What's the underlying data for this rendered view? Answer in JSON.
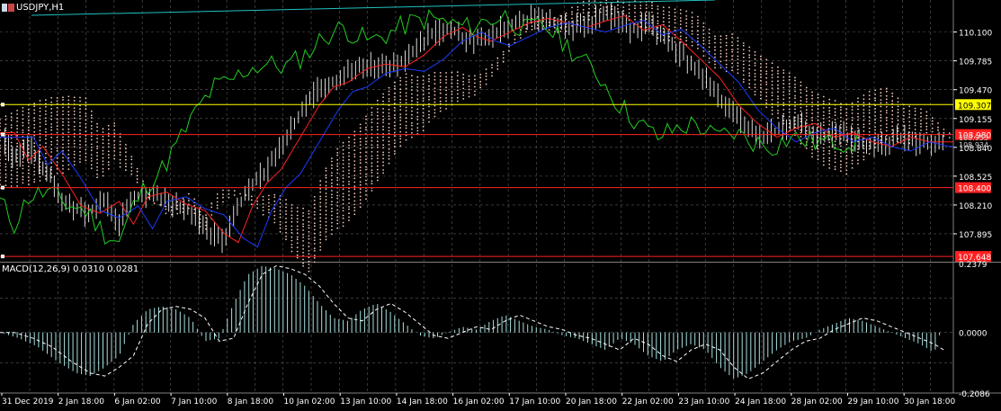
{
  "window": {
    "symbol_title": "USDJPY,H1",
    "macd_title": "MACD(12,26,9) 0.0310 0.0281"
  },
  "colors": {
    "background": "#000000",
    "grid": "#5a5a5a",
    "axis_text": "#ffffff",
    "price_bars": "#ffffff",
    "fast_ma": "#ff2020",
    "slow_ma": "#1a3cff",
    "chikou": "#22cc22",
    "cloud": "#f4c8b8",
    "horizontal_yellow": "#ffff00",
    "horizontal_red": "#ff2020",
    "trend_line": "#20c0c0",
    "macd_histogram": "#a8e0e0",
    "macd_signal": "#ffffff"
  },
  "chart_data": [
    {
      "type": "candlestick",
      "symbol": "USDJPY",
      "timeframe": "H1",
      "x_labels": [
        "31 Dec 2019",
        "2 Jan 18:00",
        "6 Jan 02:00",
        "7 Jan 10:00",
        "8 Jan 18:00",
        "10 Jan 02:00",
        "13 Jan 10:00",
        "14 Jan 18:00",
        "16 Jan 02:00",
        "17 Jan 10:00",
        "20 Jan 18:00",
        "22 Jan 02:00",
        "23 Jan 10:00",
        "24 Jan 18:00",
        "28 Jan 02:00",
        "29 Jan 10:00",
        "30 Jan 18:00"
      ],
      "y_ticks": [
        110.1,
        109.785,
        109.47,
        109.155,
        108.84,
        108.525,
        108.21,
        107.895
      ],
      "y_tick_labels": [
        "110.100",
        "109.785",
        "109.470",
        "109.155",
        "108.840",
        "108.525",
        "108.210",
        "107.895"
      ],
      "ylim": [
        107.6,
        110.45
      ],
      "price_path": [
        [
          0,
          109.0
        ],
        [
          3,
          108.7
        ],
        [
          6,
          108.85
        ],
        [
          10,
          108.55
        ],
        [
          14,
          108.2
        ],
        [
          18,
          108.12
        ],
        [
          22,
          108.25
        ],
        [
          25,
          108.0
        ],
        [
          28,
          108.3
        ],
        [
          32,
          108.35
        ],
        [
          36,
          108.22
        ],
        [
          40,
          108.15
        ],
        [
          44,
          107.9
        ],
        [
          47,
          107.8
        ],
        [
          50,
          108.2
        ],
        [
          53,
          108.45
        ],
        [
          56,
          108.6
        ],
        [
          60,
          108.95
        ],
        [
          64,
          109.3
        ],
        [
          67,
          109.5
        ],
        [
          70,
          109.55
        ],
        [
          74,
          109.7
        ],
        [
          78,
          109.75
        ],
        [
          82,
          109.72
        ],
        [
          86,
          109.85
        ],
        [
          90,
          110.05
        ],
        [
          94,
          110.15
        ],
        [
          97,
          110.05
        ],
        [
          100,
          110.0
        ],
        [
          104,
          110.1
        ],
        [
          108,
          110.2
        ],
        [
          112,
          110.25
        ],
        [
          116,
          110.2
        ],
        [
          120,
          110.15
        ],
        [
          124,
          110.22
        ],
        [
          128,
          110.28
        ],
        [
          132,
          110.12
        ],
        [
          136,
          110.18
        ],
        [
          140,
          110.0
        ],
        [
          144,
          109.8
        ],
        [
          148,
          109.6
        ],
        [
          152,
          109.3
        ],
        [
          156,
          109.1
        ],
        [
          160,
          108.95
        ],
        [
          164,
          109.05
        ],
        [
          168,
          109.1
        ],
        [
          172,
          108.95
        ],
        [
          176,
          109.0
        ],
        [
          180,
          108.9
        ],
        [
          184,
          108.85
        ],
        [
          188,
          108.95
        ],
        [
          192,
          108.9
        ],
        [
          196,
          108.9
        ]
      ],
      "levels": [
        {
          "value": 109.307,
          "label": "109.307",
          "color": "#ffff00"
        },
        {
          "value": 108.98,
          "label": "108.980",
          "color": "#ff2020"
        },
        {
          "value": 108.4,
          "label": "108.400",
          "color": "#ff2020"
        },
        {
          "value": 107.648,
          "label": "107.648",
          "color": "#ff2020"
        }
      ],
      "current_price_labels": [
        "108.955",
        "108.934"
      ]
    },
    {
      "type": "histogram",
      "indicator": "MACD(12,26,9)",
      "main_value": 0.031,
      "signal_value": 0.0281,
      "y_ticks": [
        0.2379,
        0.0,
        -0.2086
      ],
      "y_tick_labels": [
        "0.2379",
        "0.0000",
        "-0.2086"
      ],
      "ylim": [
        -0.2086,
        0.2379
      ],
      "histogram": [
        [
          0,
          0.0
        ],
        [
          4,
          -0.02
        ],
        [
          8,
          -0.05
        ],
        [
          12,
          -0.1
        ],
        [
          16,
          -0.14
        ],
        [
          19,
          -0.15
        ],
        [
          22,
          -0.12
        ],
        [
          25,
          -0.08
        ],
        [
          28,
          0.03
        ],
        [
          31,
          0.08
        ],
        [
          34,
          0.09
        ],
        [
          37,
          0.08
        ],
        [
          40,
          0.05
        ],
        [
          43,
          -0.03
        ],
        [
          46,
          -0.02
        ],
        [
          49,
          0.1
        ],
        [
          52,
          0.2
        ],
        [
          55,
          0.23
        ],
        [
          58,
          0.22
        ],
        [
          61,
          0.2
        ],
        [
          64,
          0.16
        ],
        [
          67,
          0.1
        ],
        [
          70,
          0.05
        ],
        [
          73,
          0.04
        ],
        [
          76,
          0.08
        ],
        [
          79,
          0.1
        ],
        [
          82,
          0.07
        ],
        [
          85,
          0.03
        ],
        [
          88,
          -0.01
        ],
        [
          91,
          -0.02
        ],
        [
          94,
          0.0
        ],
        [
          97,
          0.02
        ],
        [
          100,
          0.01
        ],
        [
          103,
          0.04
        ],
        [
          106,
          0.06
        ],
        [
          109,
          0.04
        ],
        [
          112,
          0.02
        ],
        [
          115,
          0.01
        ],
        [
          118,
          -0.01
        ],
        [
          121,
          -0.02
        ],
        [
          124,
          -0.04
        ],
        [
          127,
          -0.06
        ],
        [
          130,
          -0.02
        ],
        [
          133,
          -0.04
        ],
        [
          136,
          -0.08
        ],
        [
          139,
          -0.1
        ],
        [
          142,
          -0.06
        ],
        [
          145,
          -0.04
        ],
        [
          148,
          -0.06
        ],
        [
          151,
          -0.12
        ],
        [
          154,
          -0.16
        ],
        [
          157,
          -0.14
        ],
        [
          160,
          -0.1
        ],
        [
          163,
          -0.06
        ],
        [
          166,
          -0.03
        ],
        [
          169,
          -0.02
        ],
        [
          172,
          0.01
        ],
        [
          175,
          0.03
        ],
        [
          178,
          0.05
        ],
        [
          181,
          0.04
        ],
        [
          184,
          0.02
        ],
        [
          187,
          0.0
        ],
        [
          190,
          -0.02
        ],
        [
          193,
          -0.04
        ],
        [
          196,
          -0.07
        ],
        [
          198,
          0.04
        ]
      ]
    }
  ]
}
